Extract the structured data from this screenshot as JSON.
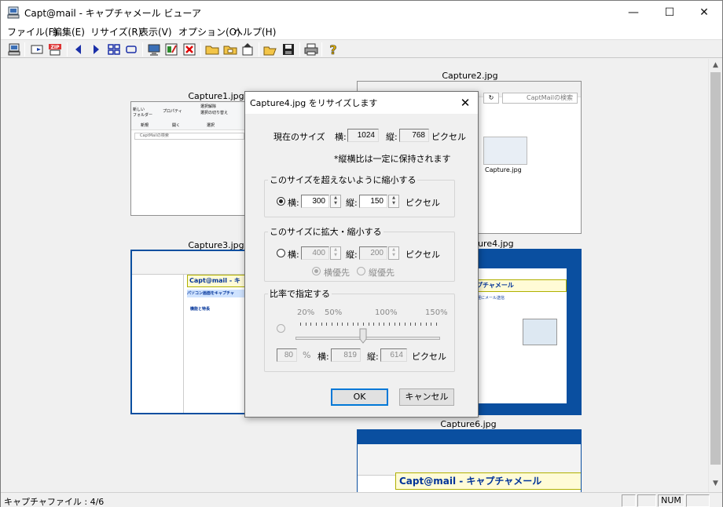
{
  "window": {
    "title": "Capt@mail - キャプチャメール ビューア",
    "minimize": "—",
    "maximize": "☐",
    "close": "✕"
  },
  "menu": [
    "ファイル(F)",
    "編集(E)",
    "リサイズ(R)",
    "表示(V)",
    "オプション(O)",
    "ヘルプ(H)"
  ],
  "toolbar": {
    "zip_label": "ZIP"
  },
  "thumbnails": {
    "capture1": "Capture1.jpg",
    "capture2": "Capture2.jpg",
    "capture3": "Capture3.jpg",
    "capture4": "Capture4.jpg",
    "capture6": "Capture6.jpg",
    "capture2_search_placeholder": "CaptMailの検索",
    "capture2_file": "Capture.jpg",
    "capture1_search": "CaptMailの検索",
    "capture1_ribbon_new": "新しい\nフォルダー",
    "capture1_ribbon_select_all": "選択解除",
    "capture1_ribbon_invert": "選択の切り替え",
    "capture1_group_new": "新規",
    "capture1_group_open": "開く",
    "capture1_group_select": "選択",
    "capture1_group_props": "プロパティ",
    "capture3_heading": "Capt@mail - キ",
    "capture3_banner": "パソコン画面をキャプチャ",
    "capture3_features": "機能と特長",
    "capture4_heading": "ャプチャメール",
    "capture4_sub": "で手軽にメール送信",
    "capture6_heading": "Capt@mail - キャプチャメール"
  },
  "status": {
    "text": "キャプチャファイル : 4/6",
    "num": "NUM"
  },
  "dialog": {
    "title": "Capture4.jpg をリサイズします",
    "current_size_label": "現在のサイズ",
    "width_label": "横:",
    "height_label": "縦:",
    "current_width": "1024",
    "current_height": "768",
    "pixel_label": "ピクセル",
    "aspect_note": "*縦横比は一定に保持されます",
    "group1_title": "このサイズを超えないように縮小する",
    "group1_width": "300",
    "group1_height": "150",
    "group2_title": "このサイズに拡大・縮小する",
    "group2_width": "400",
    "group2_height": "200",
    "priority_width": "横優先",
    "priority_height": "縦優先",
    "group3_title": "比率で指定する",
    "scale_20": "20%",
    "scale_50": "50%",
    "scale_100": "100%",
    "scale_150": "150%",
    "ratio_value": "80",
    "percent_label": "%",
    "ratio_width": "819",
    "ratio_height": "614",
    "slider_value_percent": 80,
    "selected_mode": "group1",
    "ok": "OK",
    "cancel": "キャンセル"
  },
  "colors": {
    "accent": "#0078d7",
    "thumb_blue": "#0a4fa0",
    "capt_heading_bg": "#fffbd6"
  }
}
